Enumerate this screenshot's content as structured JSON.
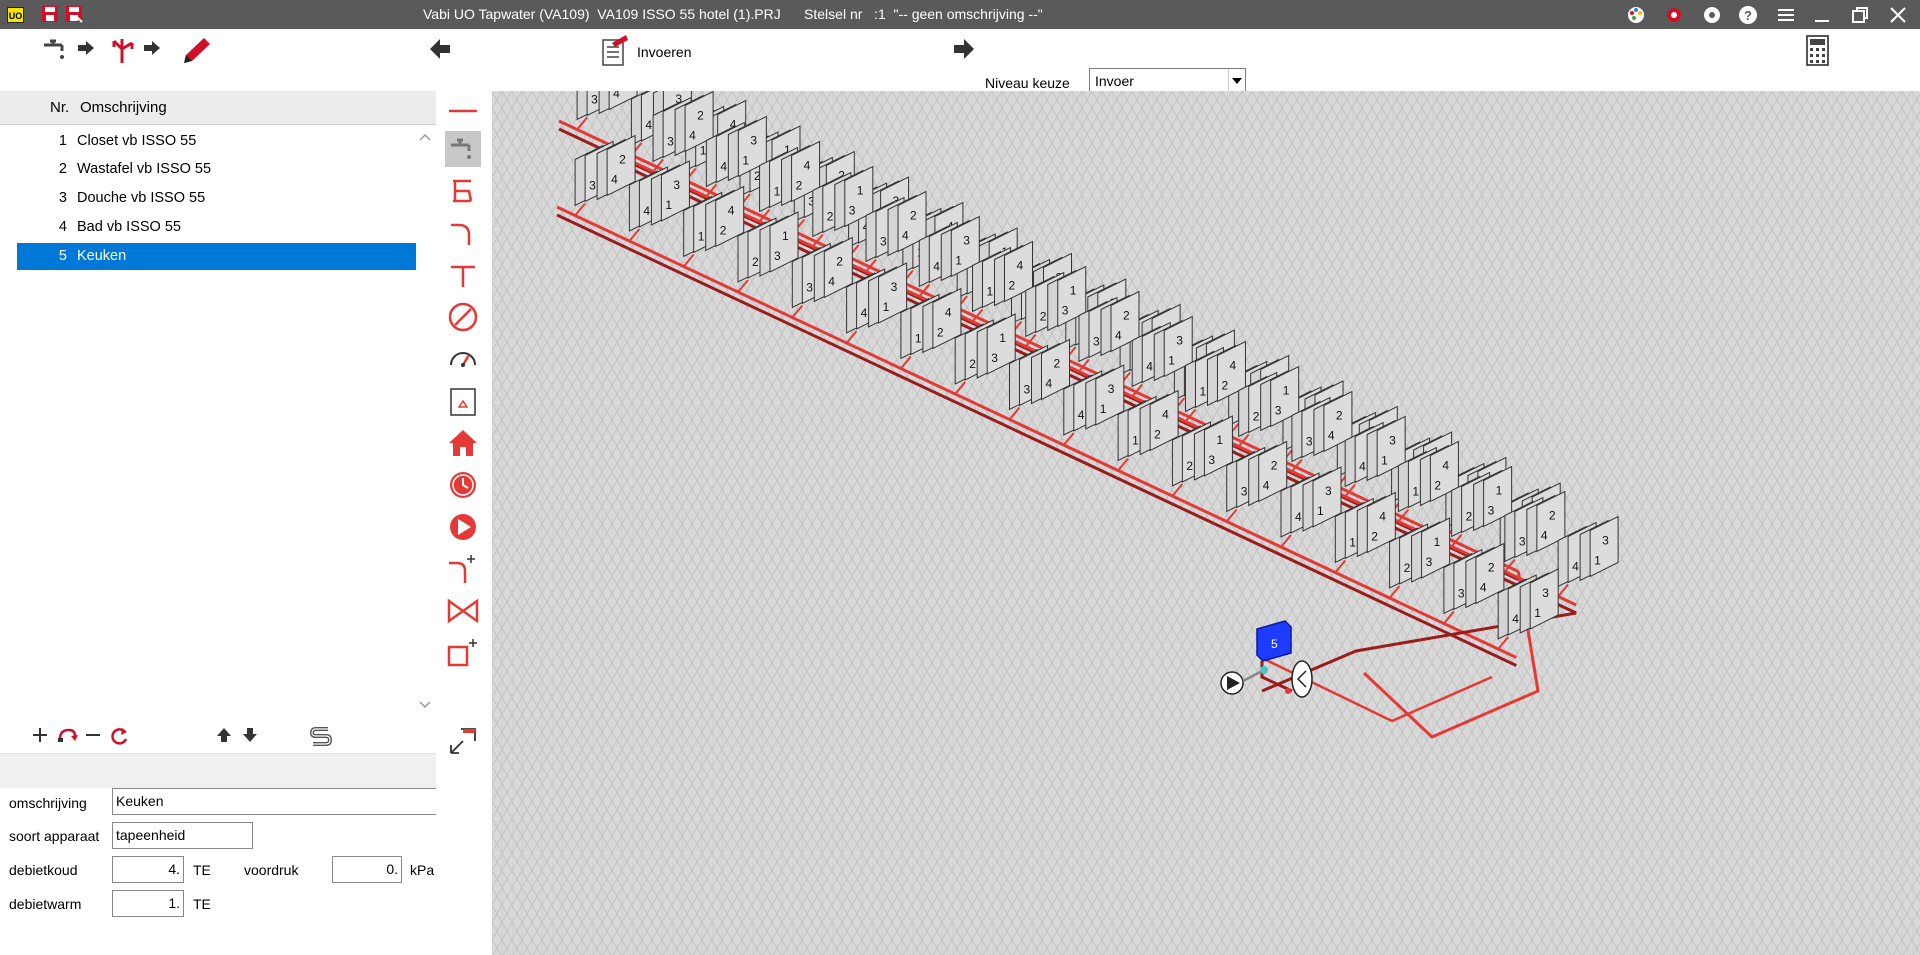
{
  "app": {
    "logo": "UO",
    "title": "Vabi UO Tapwater (VA109)  VA109 ISSO 55 hotel (1).PRJ      Stelsel nr   :1  \"-- geen omschrijving --\"",
    "titlebar_icons": [
      "save-icon",
      "save-as-icon",
      "palette-icon",
      "settings-icon",
      "gear-icon",
      "help-icon",
      "menu-icon",
      "minimize-icon",
      "restore-icon",
      "close-icon"
    ]
  },
  "toolbar": {
    "invoeren_label": "Invoeren",
    "niveau_label": "Niveau keuze",
    "niveau_value": "Invoer",
    "icons": [
      "tap-next-icon",
      "branch-next-icon",
      "pencil-icon",
      "arrow-left-icon",
      "document-icon",
      "arrow-right-icon",
      "calculator-icon"
    ]
  },
  "list": {
    "header_nr": "Nr.",
    "header_omschrijving": "Omschrijving",
    "items": [
      {
        "nr": "1",
        "omschrijving": "Closet vb ISSO 55"
      },
      {
        "nr": "2",
        "omschrijving": "Wastafel vb ISSO 55"
      },
      {
        "nr": "3",
        "omschrijving": "Douche vb ISSO 55"
      },
      {
        "nr": "4",
        "omschrijving": "Bad vb ISSO 55"
      },
      {
        "nr": "5",
        "omschrijving": "Keuken"
      }
    ],
    "selected": 4,
    "tool_icons": [
      "add-icon",
      "undo-icon",
      "remove-icon",
      "refresh-icon",
      "move-up-icon",
      "move-down-icon",
      "s-icon"
    ]
  },
  "form": {
    "omschrijving_label": "omschrijving",
    "omschrijving_value": "Keuken",
    "soort_label": "soort apparaat",
    "soort_value": "tapeenheid",
    "debietkoud_label": "debietkoud",
    "debietkoud_value": "4.",
    "debietkoud_unit": "TE",
    "voordruk_label": "voordruk",
    "voordruk_value": "0.",
    "voordruk_unit": "kPa",
    "debietwarm_label": "debietwarm",
    "debietwarm_value": "1.",
    "debietwarm_unit": "TE"
  },
  "palette": {
    "icons": [
      "pipe-icon",
      "tap-icon",
      "boiler-icon",
      "bend-icon",
      "tee-icon",
      "valve-icon",
      "gauge-icon",
      "tank-icon",
      "house-icon",
      "clock-icon",
      "pump-icon",
      "bend-add-icon",
      "butterfly-valve-icon",
      "box-add-icon",
      "corner-icon"
    ]
  },
  "canvas": {
    "fixture_labels": [
      "1",
      "2",
      "3",
      "4"
    ],
    "selected_label": "5"
  }
}
